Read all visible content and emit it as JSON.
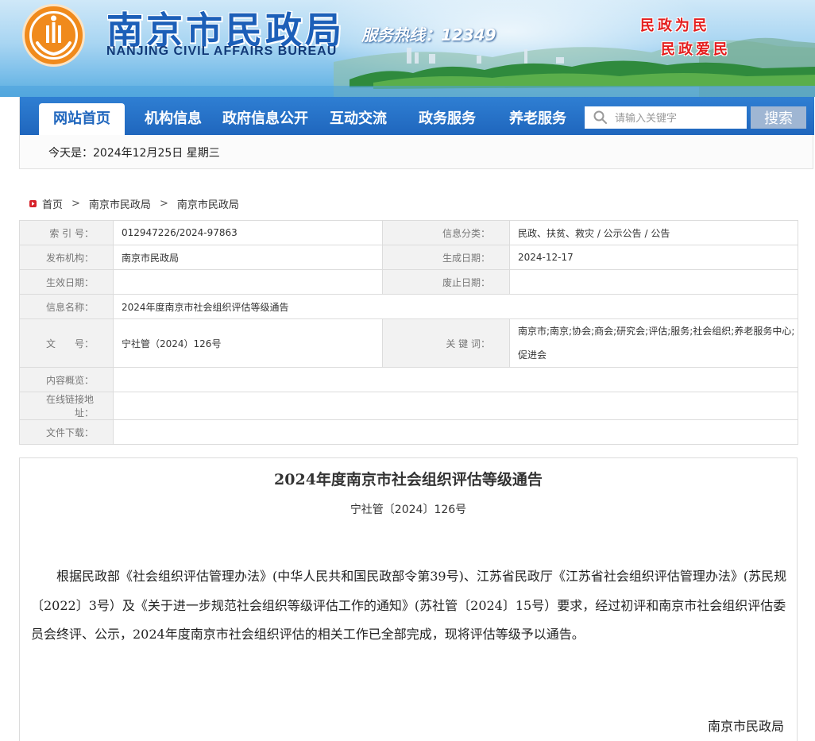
{
  "header": {
    "title_cn": "南京市民政局",
    "title_en": "NANJING CIVIL AFFAIRS BUREAU",
    "hotline": "服务热线：12349",
    "slogan_1": "民政为民",
    "slogan_2": "民政爱民",
    "logo_icon": "bureau-emblem"
  },
  "nav": {
    "items": [
      {
        "label": "网站首页",
        "active": true
      },
      {
        "label": "机构信息"
      },
      {
        "label": "政府信息公开"
      },
      {
        "label": "互动交流"
      },
      {
        "label": "政务服务"
      },
      {
        "label": "养老服务"
      }
    ],
    "search_placeholder": "请输入关键字",
    "search_button": "搜索",
    "today": "今天是：2024年12月25日 星期三"
  },
  "breadcrumb": {
    "items": [
      "首页",
      "南京市民政局",
      "南京市民政局"
    ],
    "separator": ">"
  },
  "meta": {
    "index_label": "索 引 号：",
    "index_value": "012947226/2024-97863",
    "category_label": "信息分类：",
    "category_value": "民政、扶贫、救灾 / 公示公告 / 公告",
    "publisher_label": "发布机构：",
    "publisher_value": "南京市民政局",
    "created_label": "生成日期：",
    "created_value": "2024-12-17",
    "effective_label": "生效日期：",
    "effective_value": "",
    "expiry_label": "废止日期：",
    "expiry_value": "",
    "name_label": "信息名称：",
    "name_value": "2024年度南京市社会组织评估等级通告",
    "docno_label": "文　　号：",
    "docno_value": "宁社管（2024）126号",
    "keywords_label": "关 键 词：",
    "keywords_value": "南京市;南京;协会;商会;研究会;评估;服务;社会组织;养老服务中心;促进会",
    "summary_label": "内容概览：",
    "summary_value": "",
    "link_label": "在线链接地址：",
    "link_value": "",
    "download_label": "文件下载：",
    "download_value": ""
  },
  "article": {
    "title": "2024年度南京市社会组织评估等级通告",
    "doc_no": "宁社管〔2024〕126号",
    "body": "根据民政部《社会组织评估管理办法》(中华人民共和国民政部令第39号)、江苏省民政厅《江苏省社会组织评估管理办法》(苏民规〔2022〕3号）及《关于进一步规范社会组织等级评估工作的通知》(苏社管〔2024〕15号）要求，经过初评和南京市社会组织评估委员会终评、公示，2024年度南京市社会组织评估的相关工作已全部完成，现将评估等级予以通告。",
    "signature": "南京市民政局"
  },
  "colors": {
    "nav_blue": "#1f66bd",
    "logo_orange": "#f08a1c",
    "slogan_red": "#e41e1e",
    "title_blue": "#1c5fb8"
  }
}
